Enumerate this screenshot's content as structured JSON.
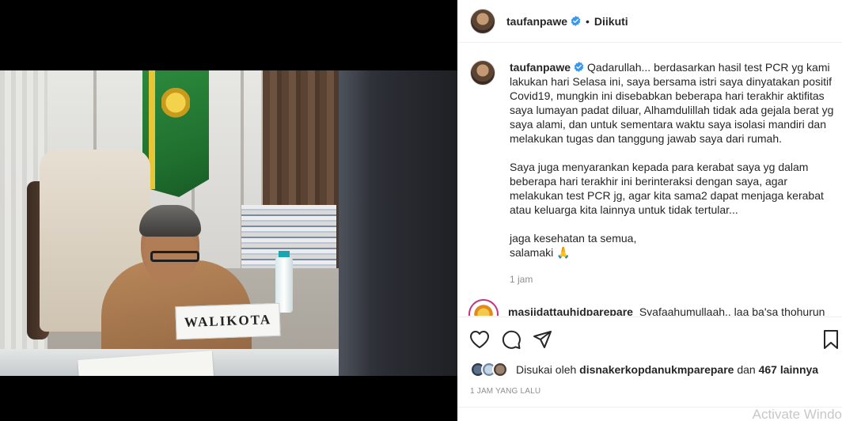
{
  "post": {
    "username": "taufanpawe",
    "follow_state": "Diikuti",
    "separator": "•",
    "caption_paragraphs": [
      "Qadarullah... berdasarkan hasil test PCR yg kami lakukan hari Selasa ini, saya bersama istri saya dinyatakan positif Covid19, mungkin ini disebabkan beberapa hari terakhir aktifitas saya lumayan padat diluar, Alhamdulillah tidak ada gejala berat yg saya alami, dan untuk sementara waktu saya isolasi mandiri dan melakukan tugas dan tanggung jawab saya dari rumah.",
      "Saya juga menyarankan kepada para kerabat saya yg dalam beberapa hari terakhir ini berinteraksi dengan saya, agar melakukan test PCR jg, agar kita sama2 dapat menjaga kerabat atau keluarga kita lainnya untuk tidak tertular...",
      "jaga kesehatan ta semua,",
      "salamaki 🙏"
    ],
    "caption_time": "1 jam",
    "photo_nameplate": "WALIKOTA"
  },
  "comments": [
    {
      "username": "masjidattauhidparepare",
      "text": "Syafaahumullaah.. laa ba'sa thohurun"
    }
  ],
  "actions": {
    "like_icon": "heart-icon",
    "comment_icon": "comment-icon",
    "share_icon": "share-icon",
    "save_icon": "bookmark-icon"
  },
  "likes": {
    "prefix": "Disukai oleh",
    "liker": "disnakerkopdanukmparepare",
    "connector": "dan",
    "others": "467 lainnya"
  },
  "timestamp": "1 JAM YANG LALU",
  "watermark": "Activate Windo",
  "colors": {
    "verified": "#3897f0",
    "text": "#262626",
    "muted": "#8e8e8e",
    "story_ring": "#c13584"
  }
}
